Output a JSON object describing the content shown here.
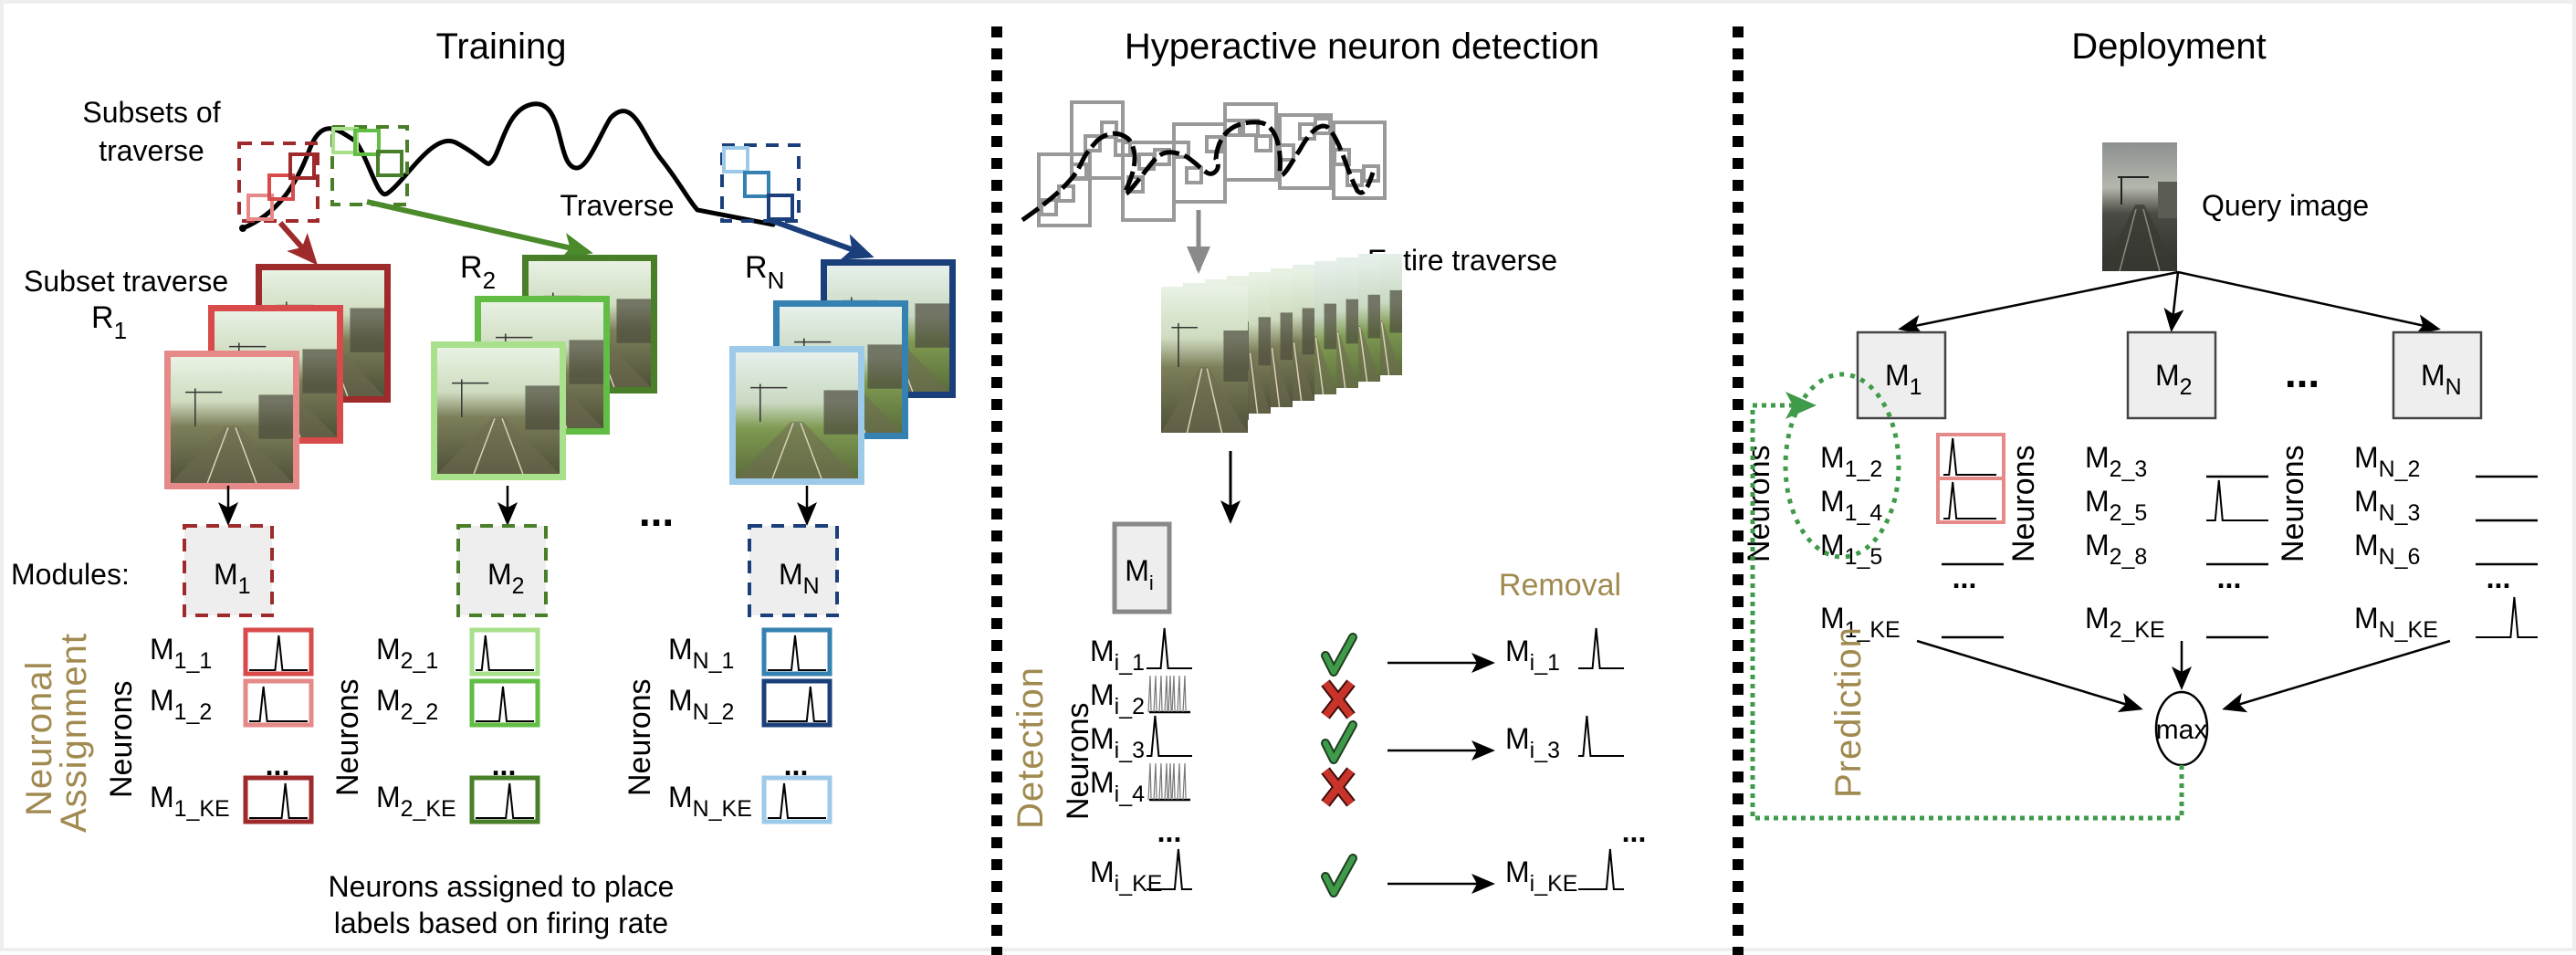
{
  "panels": {
    "training": {
      "title": "Training",
      "subsets_label_line1": "Subsets of",
      "subsets_label_line2": "traverse",
      "traverse_label": "Traverse",
      "subset_traverse_label": "Subset traverse",
      "routes": [
        {
          "main": "R",
          "sub": "1",
          "color": "#9e2a2b",
          "shades": [
            "#9e2a2b",
            "#d94a4a",
            "#e58a88"
          ]
        },
        {
          "main": "R",
          "sub": "2",
          "color": "#4a7f2a",
          "shades": [
            "#4a7f2a",
            "#62bd44",
            "#a9e08c"
          ]
        },
        {
          "main": "R",
          "sub": "N",
          "color": "#1b3f7a",
          "shades": [
            "#1b3f7a",
            "#3582b2",
            "#9dcae8"
          ]
        }
      ],
      "modules_label": "Modules:",
      "modules": [
        {
          "main": "M",
          "sub": "1",
          "border": "#9e2a2b"
        },
        {
          "main": "M",
          "sub": "2",
          "border": "#4a7f2a"
        },
        {
          "main": "M",
          "sub": "N",
          "border": "#1b3f7a"
        }
      ],
      "ellipsis": "...",
      "section_label_line1": "Neuronal",
      "section_label_line2": "Assignment",
      "neurons_axis": "Neurons",
      "neuron_groups": [
        [
          {
            "main": "M",
            "sub": "1_1",
            "border": "#d94a4a",
            "peak": 0.55
          },
          {
            "main": "M",
            "sub": "1_2",
            "border": "#e58a88",
            "peak": 0.2
          },
          {
            "main": "M",
            "sub": "1_KE",
            "border": "#9e2a2b",
            "peak": 0.7
          }
        ],
        [
          {
            "main": "M",
            "sub": "2_1",
            "border": "#a9e08c",
            "peak": 0.1
          },
          {
            "main": "M",
            "sub": "2_2",
            "border": "#62bd44",
            "peak": 0.5
          },
          {
            "main": "M",
            "sub": "2_KE",
            "border": "#4a7f2a",
            "peak": 0.65
          }
        ],
        [
          {
            "main": "M",
            "sub": "N_1",
            "border": "#3582b2",
            "peak": 0.5
          },
          {
            "main": "M",
            "sub": "N_2",
            "border": "#1b3f7a",
            "peak": 0.85
          },
          {
            "main": "M",
            "sub": "N_KE",
            "border": "#9dcae8",
            "peak": 0.25
          }
        ]
      ],
      "caption_line1": "Neurons assigned to place",
      "caption_line2": "labels based on firing rate"
    },
    "detection": {
      "title": "Hyperactive neuron detection",
      "entire_traverse_label": "Entire traverse",
      "module": {
        "main": "M",
        "sub": "i"
      },
      "removal_label": "Removal",
      "section_label": "Detection",
      "neurons_axis": "Neurons",
      "ellipsis": "...",
      "neurons": [
        {
          "main": "M",
          "sub": "i_1",
          "kind": "single",
          "peak": 0.4,
          "status": "keep"
        },
        {
          "main": "M",
          "sub": "i_2",
          "kind": "hyper",
          "status": "remove"
        },
        {
          "main": "M",
          "sub": "i_3",
          "kind": "single",
          "peak": 0.1,
          "status": "keep"
        },
        {
          "main": "M",
          "sub": "i_4",
          "kind": "hyper",
          "status": "remove"
        },
        {
          "main": "M",
          "sub": "i_KE",
          "kind": "single",
          "peak": 0.85,
          "status": "keep"
        }
      ],
      "check_color": "#3f9a4a",
      "cross_color": "#c8332a"
    },
    "deployment": {
      "title": "Deployment",
      "query_label": "Query image",
      "modules": [
        {
          "main": "M",
          "sub": "1"
        },
        {
          "main": "M",
          "sub": "2"
        },
        {
          "main": "M",
          "sub": "N"
        }
      ],
      "ellipsis": "...",
      "neurons_axis": "Neurons",
      "neuron_groups": [
        [
          {
            "main": "M",
            "sub": "1_2",
            "plot": "boxed-peak",
            "peak": 0.1
          },
          {
            "main": "M",
            "sub": "1_4",
            "plot": "boxed-peak",
            "peak": 0.1
          },
          {
            "main": "M",
            "sub": "1_5",
            "plot": "flat"
          },
          {
            "main": "M",
            "sub": "1_KE",
            "plot": "flat"
          }
        ],
        [
          {
            "main": "M",
            "sub": "2_3",
            "plot": "flat"
          },
          {
            "main": "M",
            "sub": "2_5",
            "plot": "peak",
            "peak": 0.15
          },
          {
            "main": "M",
            "sub": "2_8",
            "plot": "flat"
          },
          {
            "main": "M",
            "sub": "2_KE",
            "plot": "flat"
          }
        ],
        [
          {
            "main": "M",
            "sub": "N_2",
            "plot": "flat"
          },
          {
            "main": "M",
            "sub": "N_3",
            "plot": "flat"
          },
          {
            "main": "M",
            "sub": "N_6",
            "plot": "flat"
          },
          {
            "main": "M",
            "sub": "N_KE",
            "plot": "peak",
            "peak": 0.7
          }
        ]
      ],
      "max_label": "max",
      "section_label": "Prediction",
      "highlight_color": "#e58a88",
      "feedback_color": "#3f9a4a"
    }
  },
  "colors": {
    "section_gold": "#a08a4f",
    "module_fill": "#eeeeee",
    "grey_window": "#999999"
  }
}
